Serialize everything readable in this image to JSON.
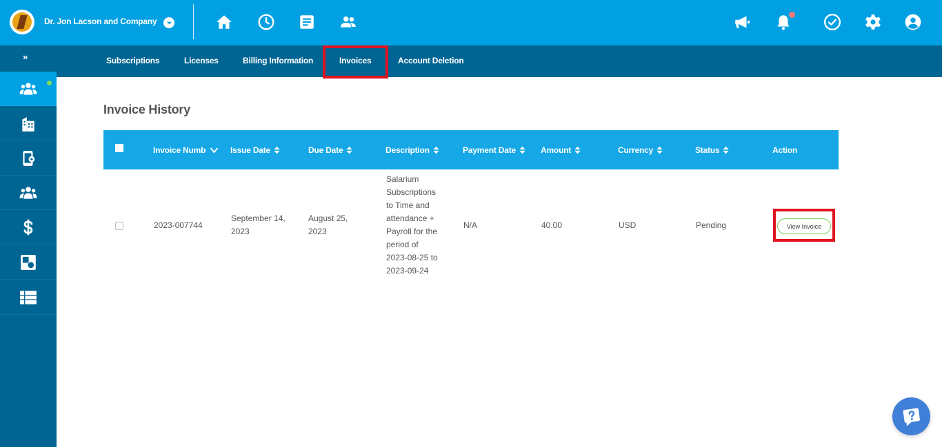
{
  "header": {
    "company_name": "Dr. Jon Lacson and Company",
    "nav_icons": [
      "home-icon",
      "clock-icon",
      "document-icon",
      "people-icon"
    ],
    "right_icons": [
      "megaphone-icon",
      "bell-icon",
      "check-circle-icon",
      "gear-icon",
      "user-icon"
    ],
    "brand_color": "#00a0e3",
    "notification_dot_color": "#f27a7a"
  },
  "subnav": {
    "expand_label": "»",
    "tabs": [
      {
        "label": "Subscriptions"
      },
      {
        "label": "Licenses"
      },
      {
        "label": "Billing Information"
      },
      {
        "label": "Invoices",
        "active": true
      },
      {
        "label": "Account Deletion"
      }
    ]
  },
  "sidebar": {
    "items": [
      "employees-icon",
      "building-icon",
      "mobile-settings-icon",
      "team-icon",
      "dollar-icon",
      "shapes-icon",
      "list-icon"
    ],
    "active": "employees-icon",
    "color": "#006593"
  },
  "main": {
    "title": "Invoice History",
    "table": {
      "columns": [
        "Invoice Numb",
        "Issue Date",
        "Due Date",
        "Description",
        "Payment Date",
        "Amount",
        "Currency",
        "Status",
        "Action"
      ],
      "rows": [
        {
          "invoice_number": "2023-007744",
          "issue_date": "September 14, 2023",
          "due_date": "August 25, 2023",
          "description_lines": [
            "Salarium",
            "Subscriptions",
            "to Time and",
            "attendance +",
            "Payroll for the",
            "period of",
            "2023-08-25 to",
            "2023-09-24"
          ],
          "payment_date": "N/A",
          "amount": "40.00",
          "currency": "USD",
          "status": "Pending",
          "action_label": "View Invoice"
        }
      ]
    }
  }
}
